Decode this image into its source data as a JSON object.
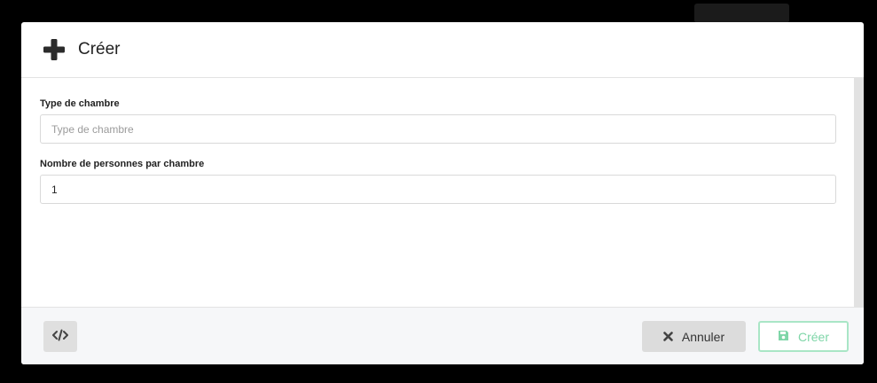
{
  "modal": {
    "title": "Créer",
    "header_icon": "plus-icon"
  },
  "form": {
    "room_type": {
      "label": "Type de chambre",
      "placeholder": "Type de chambre",
      "value": ""
    },
    "persons_per_room": {
      "label": "Nombre de personnes par chambre",
      "value": "1"
    }
  },
  "footer": {
    "code_icon": "code-icon",
    "cancel_label": "Annuler",
    "cancel_icon": "times-icon",
    "create_label": "Créer",
    "create_icon": "save-icon"
  },
  "colors": {
    "create_accent": "#7fd6a8",
    "create_border": "#a9e6c6",
    "cancel_bg": "#dcdcdc"
  }
}
